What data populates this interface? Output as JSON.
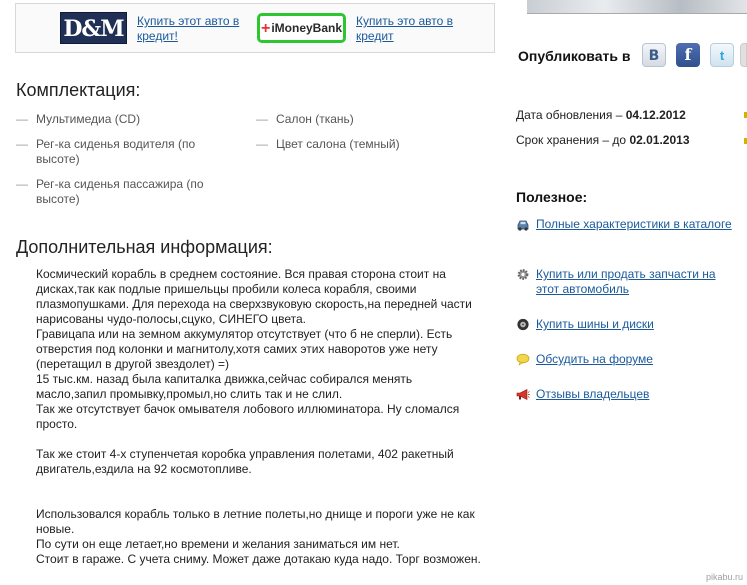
{
  "credit": {
    "link1": "Купить этот авто в кредит!",
    "link2": "Купить это авто в кредит",
    "logo_dm": "D&M",
    "logo_imoney_plus": "+",
    "logo_imoney": "iMoneyBank"
  },
  "share": {
    "label": "Опубликовать в",
    "vk": "B",
    "fb": "f",
    "tw": "t"
  },
  "equipment": {
    "title": "Комплектация:",
    "dash": "—",
    "col1": [
      "Мультимедиа (CD)",
      "Рег-ка сиденья водителя (по высоте)",
      "Рег-ка сиденья пассажира (по высоте)"
    ],
    "col2": [
      "Салон (ткань)",
      "Цвет салона (темный)"
    ]
  },
  "additional": {
    "title": "Дополнительная информация:",
    "lines": [
      "Космический корабль в среднем состояние. Вся правая сторона стоит на",
      "дисках,так как подлые пришельцы пробили колеса корабля, своими",
      "плазмопушками. Для перехода на сверхзвуковую скорость,на передней части",
      "нарисованы чудо-полосы,сцуко, СИНЕГО цвета.",
      "Гравицапа или на земном аккумулятор отсутствует (что б не сперли). Есть",
      "отверстия под колонки и магнитолу,хотя самих этих наворотов уже нету",
      "(перетащил в другой звездолет) =)",
      "15 тыс.км. назад была капиталка движка,сейчас собирался менять",
      "масло,запил промывку,промыл,но слить так и не слил.",
      "Так же отсутствует бачок омывателя лобового иллюминатора. Ну сломался",
      "просто.",
      "",
      "Так же стоит 4-х ступенчетая коробка управления полетами, 402 ракетный",
      "двигатель,ездила на 92 космотопливе.",
      "",
      "",
      "Использовался корабль только в летние полеты,но днище и пороги уже не как",
      "новые.",
      "По сути он еще летает,но времени и желания заниматься им нет.",
      "Стоит в гараже. С учета сниму. Может даже дотакаю куда надо. Торг возможен."
    ]
  },
  "meta": {
    "updated_label": "Дата обновления – ",
    "updated_value": "04.12.2012",
    "storage_label": "Срок хранения – до ",
    "storage_value": "02.01.2013"
  },
  "useful": {
    "title": "Полезное:",
    "items": [
      {
        "label": "Полные характеристики в каталоге",
        "icon": "car-icon"
      },
      {
        "label": "Купить или продать запчасти на этот автомобиль",
        "icon": "gear-icon"
      },
      {
        "label": "Купить шины и диски",
        "icon": "tire-icon"
      },
      {
        "label": "Обсудить на форуме",
        "icon": "speech-bubble-icon"
      },
      {
        "label": "Отзывы владельцев",
        "icon": "megaphone-icon"
      }
    ]
  },
  "watermark": "pikabu.ru",
  "colors": {
    "link": "#1a5a9c",
    "imoney_green": "#2dc630",
    "dm_navy": "#1f2f55",
    "facebook": "#3b5998",
    "twitter": "#2ba7e0"
  }
}
